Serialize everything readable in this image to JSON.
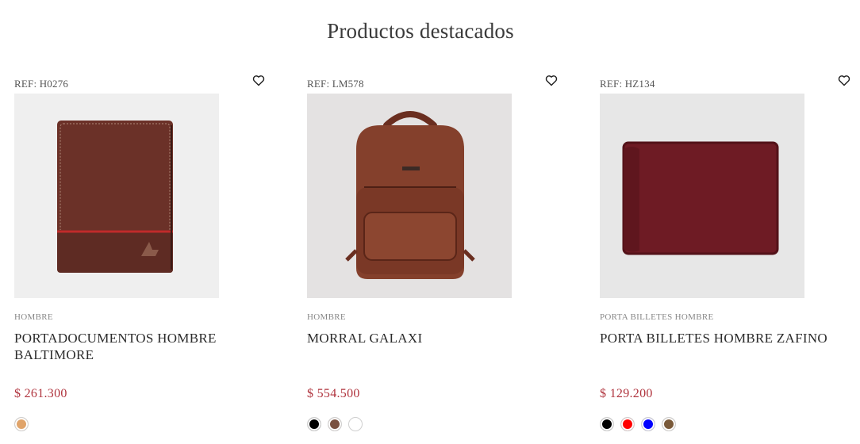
{
  "section": {
    "title": "Productos destacados"
  },
  "products": [
    {
      "ref": "REF: H0276",
      "category": "HOMBRE",
      "name": "PORTADOCUMENTOS HOMBRE BALTIMORE",
      "price": "$ 261.300",
      "image": "brown-leather-document-holder",
      "colors": [
        "#e0a46a"
      ]
    },
    {
      "ref": "REF: LM578",
      "category": "HOMBRE",
      "name": "MORRAL GALAXI",
      "price": "$ 554.500",
      "image": "brown-leather-backpack",
      "colors": [
        "#000000",
        "#7a5140",
        "#ffffff"
      ]
    },
    {
      "ref": "REF: HZ134",
      "category": "PORTA BILLETES HOMBRE",
      "name": "PORTA BILLETES HOMBRE ZAFINO",
      "price": "$ 129.200",
      "image": "burgundy-billfold-wallet",
      "colors": [
        "#000000",
        "#ff0000",
        "#0000ff",
        "#7a5a3a"
      ]
    }
  ],
  "icons": {
    "wishlist": "heart-outline-icon"
  }
}
